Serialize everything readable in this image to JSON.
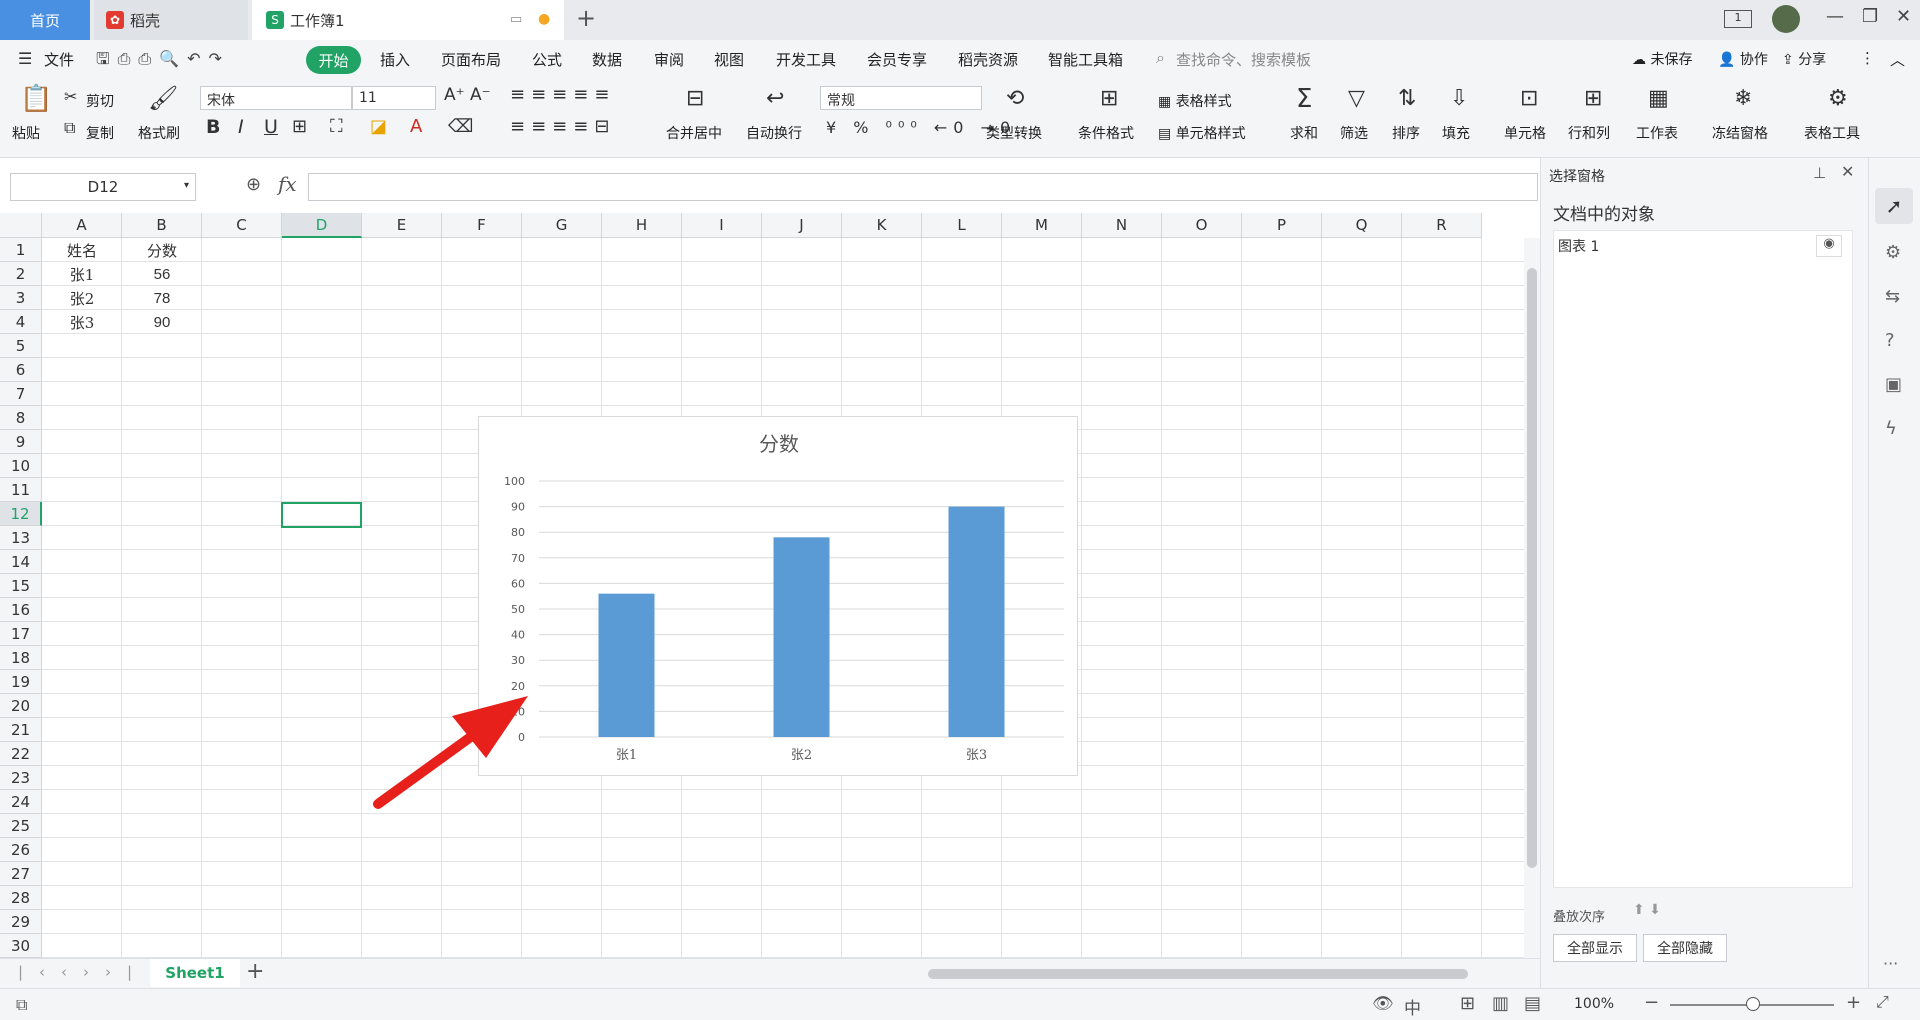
{
  "tabs": {
    "home": "首页",
    "daoke": "稻壳",
    "workbook": "工作簿1"
  },
  "menu": {
    "file": "文件",
    "items": [
      "开始",
      "插入",
      "页面布局",
      "公式",
      "数据",
      "审阅",
      "视图",
      "开发工具",
      "会员专享",
      "稻壳资源",
      "智能工具箱"
    ],
    "search": "查找命令、搜索模板",
    "unsaved": "未保存",
    "collab": "协作",
    "share": "分享"
  },
  "ribbon": {
    "paste": "粘贴",
    "cut": "剪切",
    "copy": "复制",
    "format_painter": "格式刷",
    "font": "宋体",
    "font_size": "11",
    "merge": "合并居中",
    "wrap": "自动换行",
    "number_format": "常规",
    "type_convert": "类型转换",
    "cond_format": "条件格式",
    "table_style": "表格样式",
    "cell_style": "单元格样式",
    "sum": "求和",
    "filter": "筛选",
    "sort": "排序",
    "fill": "填充",
    "cell": "单元格",
    "rowcol": "行和列",
    "worksheet": "工作表",
    "freeze": "冻结窗格",
    "table_tools": "表格工具"
  },
  "namebox": "D12",
  "fx": "fx",
  "columns": [
    "A",
    "B",
    "C",
    "D",
    "E",
    "F",
    "G",
    "H",
    "I",
    "J",
    "K",
    "L",
    "M",
    "N",
    "O",
    "P",
    "Q",
    "R"
  ],
  "rows": [
    "1",
    "2",
    "3",
    "4",
    "5",
    "6",
    "7",
    "8",
    "9",
    "10",
    "11",
    "12",
    "13",
    "14",
    "15",
    "16",
    "17",
    "18",
    "19",
    "20",
    "21",
    "22",
    "23",
    "24",
    "25",
    "26",
    "27",
    "28",
    "29",
    "30"
  ],
  "cells": {
    "a1": "姓名",
    "b1": "分数",
    "a2": "张1",
    "b2": "56",
    "a3": "张2",
    "b3": "78",
    "a4": "张3",
    "b4": "90"
  },
  "chart_data": {
    "type": "bar",
    "title": "分数",
    "categories": [
      "张1",
      "张2",
      "张3"
    ],
    "values": [
      56,
      78,
      90
    ],
    "ylim": [
      0,
      100
    ],
    "yticks": [
      "0",
      "10",
      "20",
      "30",
      "40",
      "50",
      "60",
      "70",
      "80",
      "90",
      "100"
    ],
    "grid": true,
    "bar_color": "#5b9bd5"
  },
  "pane": {
    "title": "选择窗格",
    "section": "文档中的对象",
    "object": "图表 1",
    "order": "叠放次序",
    "show_all": "全部显示",
    "hide_all": "全部隐藏"
  },
  "sheet": {
    "name": "Sheet1"
  },
  "status": {
    "zoom": "100%"
  },
  "colors": {
    "accent": "#21a366",
    "tab_blue": "#4a90e2",
    "arrow": "#e8201c"
  }
}
